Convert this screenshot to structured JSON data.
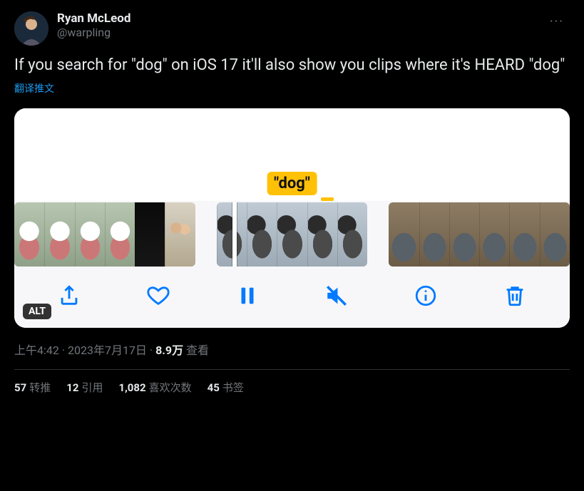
{
  "author": {
    "display_name": "Ryan McLeod",
    "handle": "@warpling"
  },
  "menu": {
    "more_label": "···"
  },
  "content_text": "If you search for \"dog\" on iOS 17 it'll also show you clips where it's HEARD \"dog\"",
  "translate_label": "翻译推文",
  "media": {
    "caption_word": "\"dog\"",
    "alt_badge": "ALT",
    "controls": {
      "share": "share",
      "like": "like",
      "pause": "pause",
      "mute": "mute",
      "info": "info",
      "delete": "delete"
    }
  },
  "meta": {
    "time": "上午4:42",
    "sep": " · ",
    "date": "2023年7月17日",
    "views_count": "8.9万",
    "views_label": " 查看"
  },
  "stats": {
    "retweets_num": "57",
    "retweets_label": "转推",
    "quotes_num": "12",
    "quotes_label": "引用",
    "likes_num": "1,082",
    "likes_label": "喜欢次数",
    "bookmarks_num": "45",
    "bookmarks_label": "书签"
  }
}
